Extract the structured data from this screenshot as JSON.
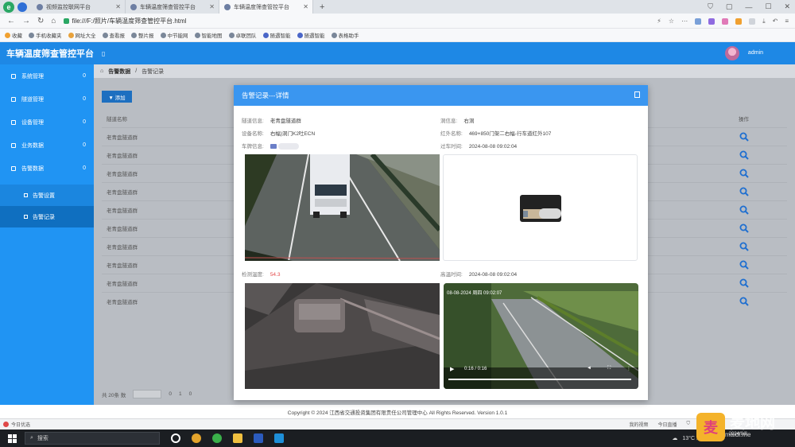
{
  "browser": {
    "tabs": [
      {
        "label": "视频监控联网平台"
      },
      {
        "label": "车辆温度筛查管控平台"
      },
      {
        "label": "车辆温度筛查管控平台"
      }
    ],
    "address": "file:///F:/照片/车辆温度筛查管控平台.html",
    "bookmarks": [
      "收藏",
      "手机收藏夹",
      "网址大全",
      "查看报",
      "整片报",
      "中节能网",
      "智能地图",
      "卓联团队",
      "随遇智能",
      "随遇智能",
      "表格助手"
    ]
  },
  "app": {
    "title": "车辆温度筛查管控平台",
    "username": "admin",
    "colors": {
      "primary": "#1e88e5",
      "sidebar": "#2094f3",
      "danger": "#e54b4b"
    }
  },
  "sidebar": {
    "items": [
      {
        "label": "系统管理",
        "count": "0"
      },
      {
        "label": "隧道管理",
        "count": "0"
      },
      {
        "label": "设备管理",
        "count": "0"
      },
      {
        "label": "业务数据",
        "count": "0"
      },
      {
        "label": "告警数据",
        "count": "0"
      }
    ],
    "sub_items": [
      {
        "label": "告警设置"
      },
      {
        "label": "告警记录"
      }
    ]
  },
  "breadcrumb": {
    "home": "告警数据",
    "current": "告警记录"
  },
  "list": {
    "add_label": "▼ 添加",
    "header_col1": "隧道名称",
    "header_op": "操作",
    "rows": [
      {
        "tunnel": "老青盘隧道群"
      },
      {
        "tunnel": "老青盘隧道群"
      },
      {
        "tunnel": "老青盘隧道群"
      },
      {
        "tunnel": "老青盘隧道群"
      },
      {
        "tunnel": "老青盘隧道群"
      },
      {
        "tunnel": "老青盘隧道群"
      },
      {
        "tunnel": "老青盘隧道群"
      },
      {
        "tunnel": "老青盘隧道群"
      },
      {
        "tunnel": "老青盘隧道群"
      },
      {
        "tunnel": "老青盘隧道群"
      }
    ],
    "pager": {
      "total": "共 20条 数",
      "page_size": "10 条/页",
      "prev": "0",
      "page": "1",
      "next": "0"
    }
  },
  "modal": {
    "title": "告警记录---详情",
    "fields": {
      "tunnel_label": "隧道信息:",
      "tunnel_value": "老青盘隧道群",
      "device_label": "设备名称:",
      "device_value": "右幅)洞门K2吐ECN",
      "plate_label": "车牌信息:",
      "hole_label": "洞信息:",
      "hole_value": "右洞",
      "ir_label": "红外名称:",
      "ir_value": "469+850门架二右幅-行车道红外107",
      "pass_label": "过车时间:",
      "pass_value": "2024-08-08 09:02:04",
      "temp_label": "检测温度:",
      "temp_value": "54.3",
      "alarm_label": "高温时间:",
      "alarm_value": "2024-08-08 09:02:04"
    },
    "video": {
      "overlay_time": "08-08-2024 周四 09:02:07",
      "elapsed": "0:16 / 0:16"
    }
  },
  "footer": {
    "copyright": "Copyright © 2024 江西省交通投资集团有限责任公司管理中心  All Rights Reserved. Version 1.0.1"
  },
  "status_bar": {
    "left": "今日优选",
    "items": [
      "我的视频",
      "今日直播"
    ]
  },
  "taskbar": {
    "search": "搜索",
    "weather": "13°C 晴朗",
    "date": "2024/8/8"
  },
  "watermark": {
    "logo": "麦",
    "brand": "麦地网",
    "domain": "maidi.me"
  }
}
